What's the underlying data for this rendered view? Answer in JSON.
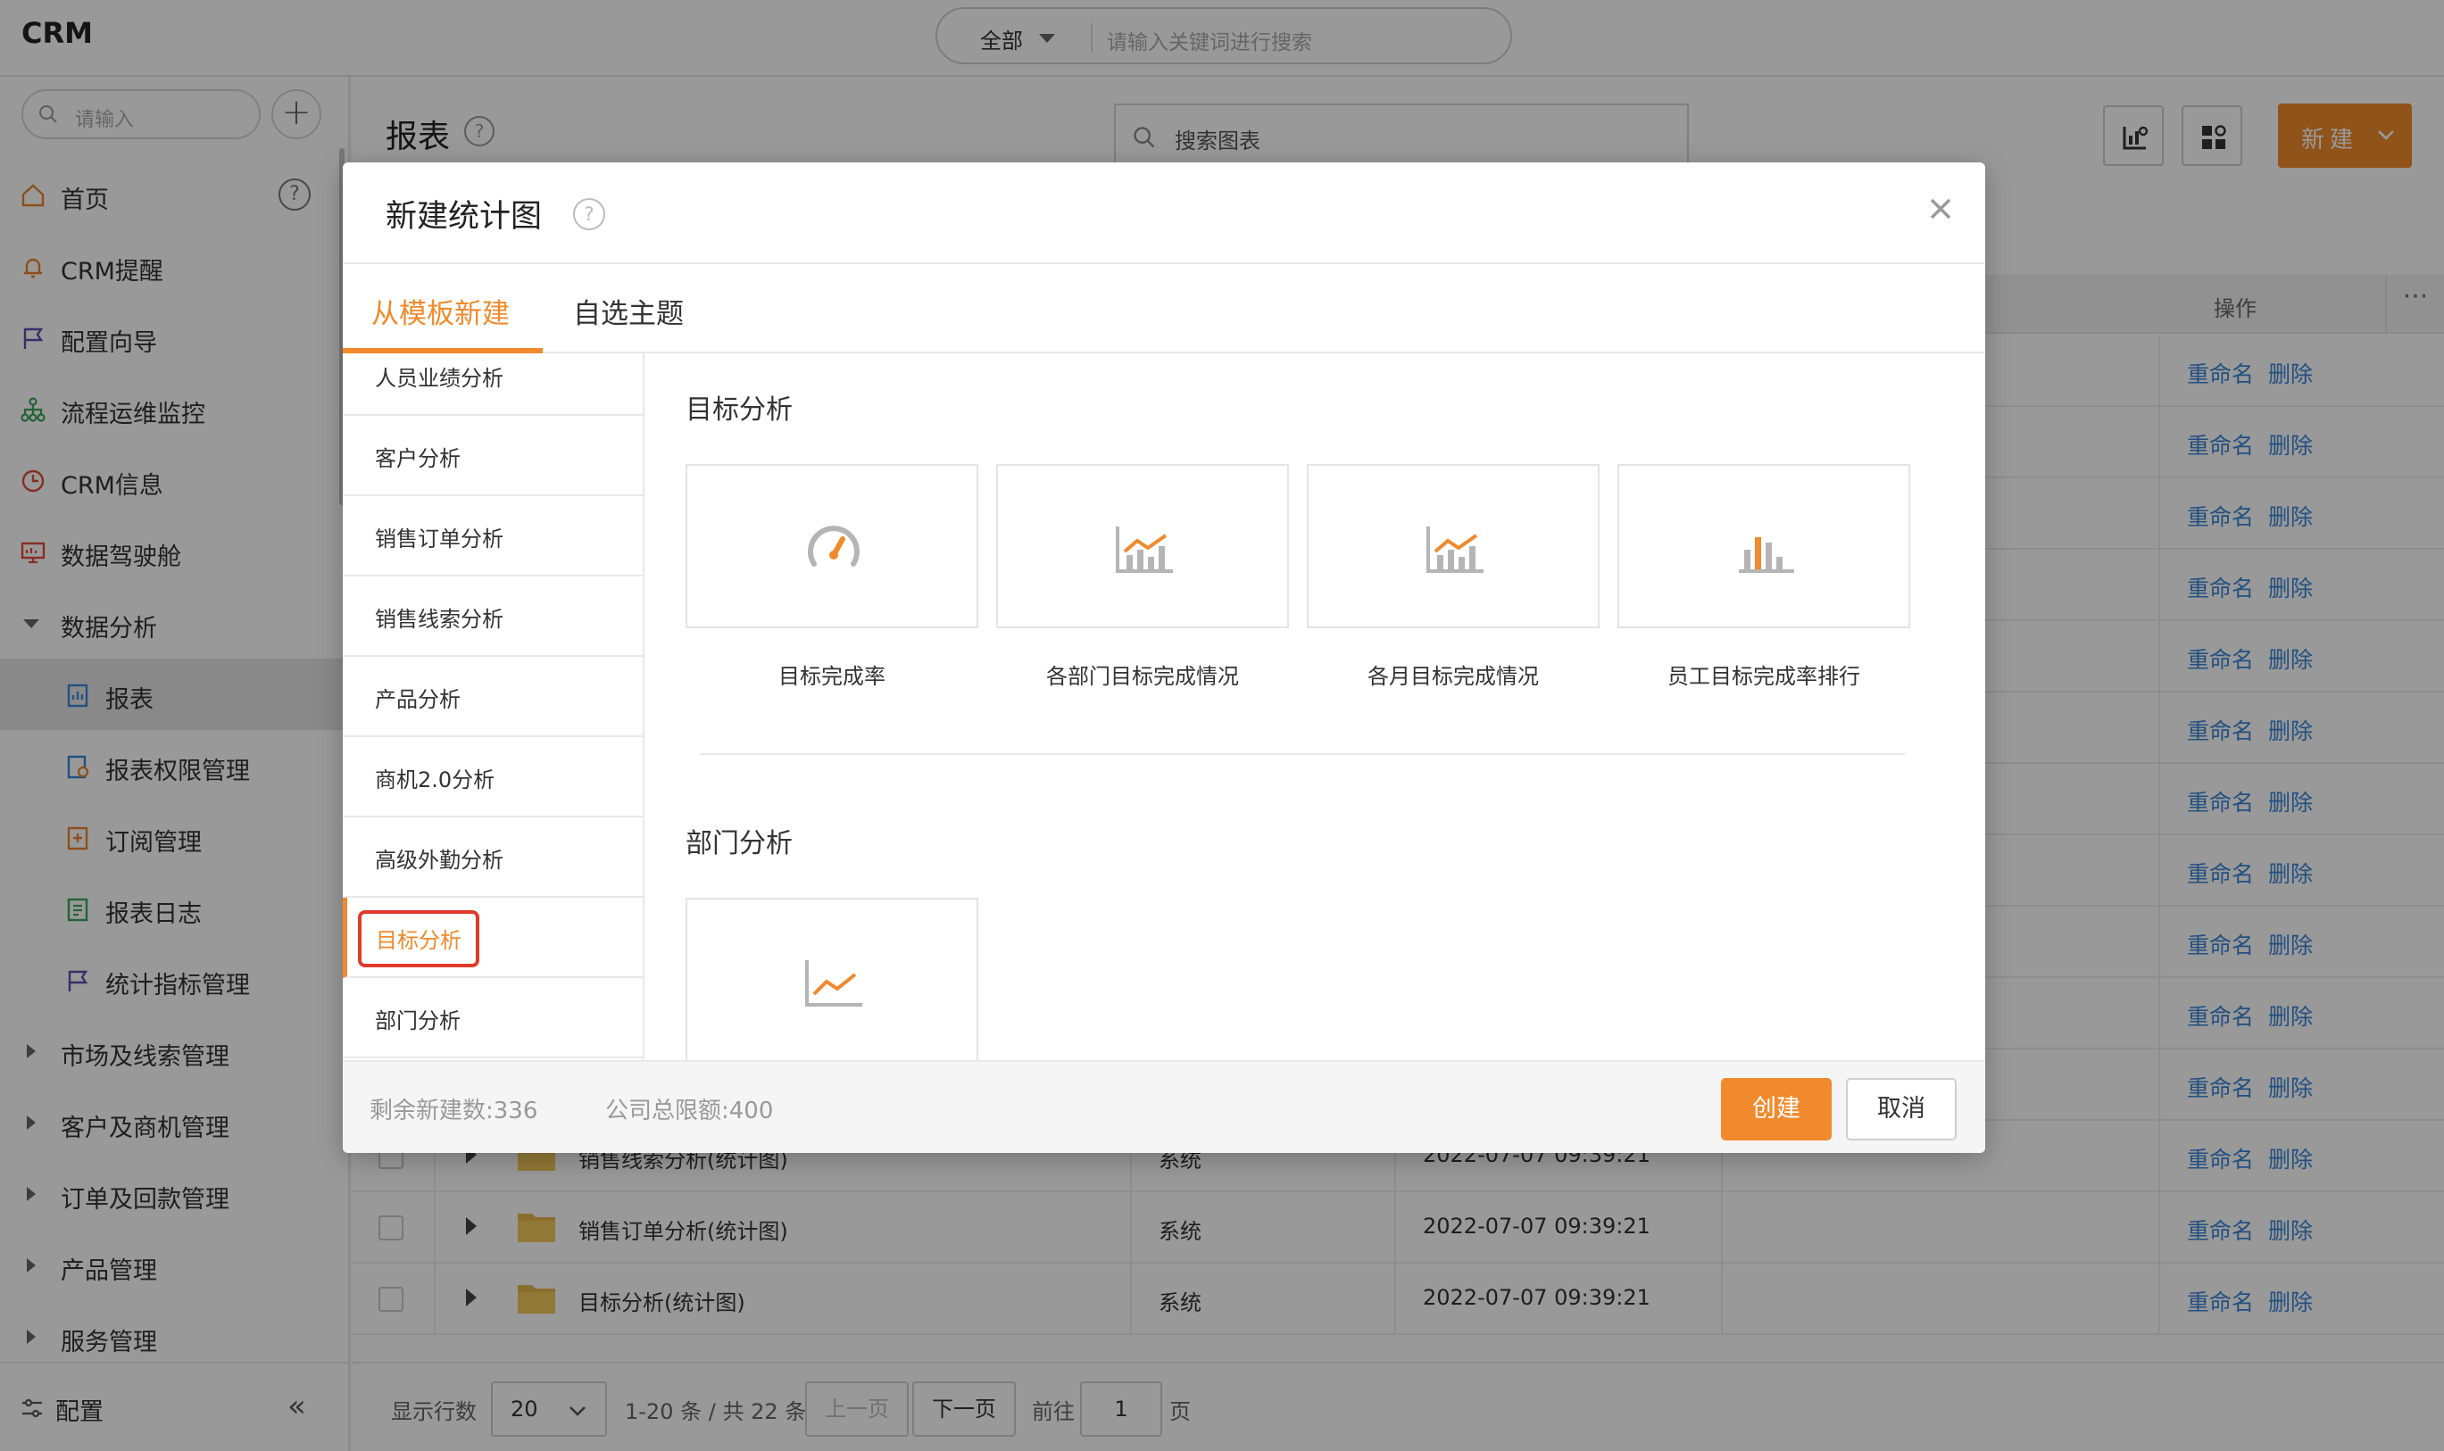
{
  "app": {
    "title": "CRM"
  },
  "global_search": {
    "scope": "全部",
    "placeholder": "请输入关键词进行搜索"
  },
  "sidebar": {
    "search_placeholder": "请输入",
    "items": [
      {
        "label": "首页",
        "icon": "home-icon"
      },
      {
        "label": "CRM提醒",
        "icon": "bell-icon"
      },
      {
        "label": "配置向导",
        "icon": "flag-icon"
      },
      {
        "label": "流程运维监控",
        "icon": "org-chart-icon"
      },
      {
        "label": "CRM信息",
        "icon": "clock-icon"
      },
      {
        "label": "数据驾驶舱",
        "icon": "monitor-icon"
      },
      {
        "label": "数据分析",
        "icon": "caret-down-icon"
      },
      {
        "label": "报表",
        "icon": "report-icon"
      },
      {
        "label": "报表权限管理",
        "icon": "report-permission-icon"
      },
      {
        "label": "订阅管理",
        "icon": "subscription-icon"
      },
      {
        "label": "报表日志",
        "icon": "log-icon"
      },
      {
        "label": "统计指标管理",
        "icon": "flag-icon"
      },
      {
        "label": "市场及线索管理",
        "icon": "caret-right-icon"
      },
      {
        "label": "客户及商机管理",
        "icon": "caret-right-icon"
      },
      {
        "label": "订单及回款管理",
        "icon": "caret-right-icon"
      },
      {
        "label": "产品管理",
        "icon": "caret-right-icon"
      },
      {
        "label": "服务管理",
        "icon": "caret-right-icon"
      }
    ],
    "footer_label": "配置",
    "help_glyph": "?",
    "collapse_glyph": "«"
  },
  "main": {
    "title": "报表",
    "chart_search_placeholder": "搜索图表",
    "new_button": "新建",
    "ops_header": "操作",
    "more_glyph": "···",
    "row_actions": {
      "rename": "重命名",
      "delete": "删除"
    },
    "visible_rows": [
      {
        "name": "销售线索分析(统计图)",
        "type": "系统",
        "time": "2022-07-07 09:39:21"
      },
      {
        "name": "销售订单分析(统计图)",
        "type": "系统",
        "time": "2022-07-07 09:39:21"
      },
      {
        "name": "目标分析(统计图)",
        "type": "系统",
        "time": "2022-07-07 09:39:21"
      }
    ],
    "pager": {
      "rows_label": "显示行数",
      "rows_value": "20",
      "range": "1-20 条 / 共 22 条",
      "prev": "上一页",
      "next": "下一页",
      "goto_label": "前往",
      "goto_value": "1",
      "page_unit": "页"
    }
  },
  "modal": {
    "title": "新建统计图",
    "help_glyph": "?",
    "tabs": [
      {
        "label": "从模板新建",
        "active": true
      },
      {
        "label": "自选主题",
        "active": false
      }
    ],
    "categories": [
      {
        "label": "人员业绩分析"
      },
      {
        "label": "客户分析"
      },
      {
        "label": "销售订单分析"
      },
      {
        "label": "销售线索分析"
      },
      {
        "label": "产品分析"
      },
      {
        "label": "商机2.0分析"
      },
      {
        "label": "高级外勤分析"
      },
      {
        "label": "目标分析",
        "selected": true
      },
      {
        "label": "部门分析"
      }
    ],
    "sections": [
      {
        "title": "目标分析",
        "templates": [
          {
            "label": "目标完成率",
            "icon": "gauge-icon"
          },
          {
            "label": "各部门目标完成情况",
            "icon": "bar-line-chart-icon"
          },
          {
            "label": "各月目标完成情况",
            "icon": "bar-line-chart-icon"
          },
          {
            "label": "员工目标完成率排行",
            "icon": "bar-chart-icon"
          }
        ]
      },
      {
        "title": "部门分析",
        "templates": [
          {
            "label": "",
            "icon": "line-chart-icon"
          }
        ]
      }
    ],
    "footer": {
      "remaining": "剩余新建数:336",
      "company_limit": "公司总限额:400",
      "create": "创建",
      "cancel": "取消"
    },
    "accent_color": "#f08a2c",
    "highlight_color": "#e03a2a"
  }
}
